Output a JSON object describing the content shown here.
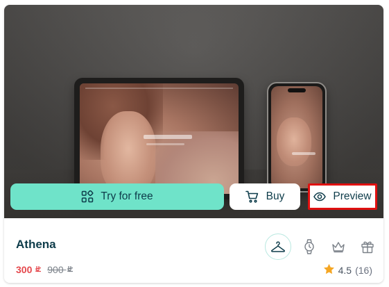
{
  "actions": {
    "try_label": "Try for free",
    "buy_label": "Buy",
    "preview_label": "Preview"
  },
  "product": {
    "title": "Athena",
    "price_current": "300",
    "price_old": "900",
    "currency_symbol": "⃁",
    "rating": "4.5",
    "rating_count": "(16)"
  },
  "categories": [
    {
      "icon": "hanger-icon",
      "active": true
    },
    {
      "icon": "watch-icon",
      "active": false
    },
    {
      "icon": "crown-icon",
      "active": false
    },
    {
      "icon": "gift-icon",
      "active": false
    }
  ],
  "colors": {
    "accent": "#6fe3c9",
    "text_dark": "#0e3c4a",
    "price_red": "#e5484d",
    "highlight_border": "#e01010",
    "star": "#f5a623"
  }
}
